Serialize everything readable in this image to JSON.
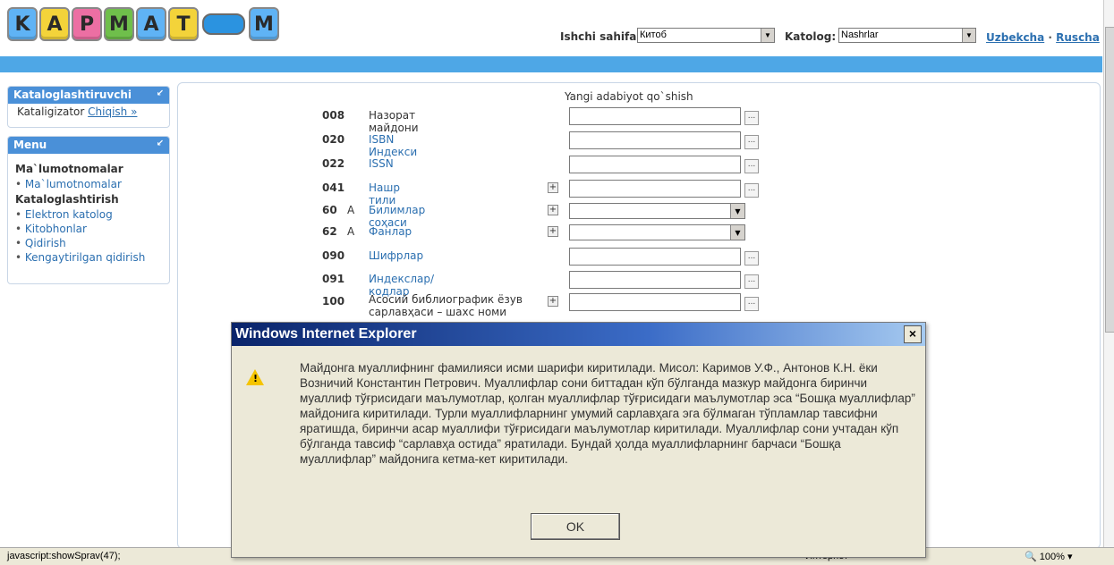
{
  "logo": {
    "letters": [
      "K",
      "A",
      "P",
      "M",
      "A",
      "T",
      "M"
    ],
    "colors": [
      "#5fb3f5",
      "#f3d33a",
      "#ec6fa3",
      "#6fbf4b",
      "#5fb3f5",
      "#f3d33a",
      "#5fb3f5"
    ]
  },
  "header": {
    "work_page_label": "Ishchi sahifa:",
    "work_page_value": "Китоб",
    "catalog_label": "Katolog:",
    "catalog_value": "Nashrlar",
    "lang_uz": "Uzbekcha",
    "lang_sep": "·",
    "lang_ru": "Ruscha"
  },
  "sidebar": {
    "cataloger_box": {
      "title": "Kataloglashtiruvchi",
      "user": "Kataligizator",
      "logout": "Chiqish »"
    },
    "menu_box": {
      "title": "Menu",
      "groups": [
        {
          "title": "Ma`lumotnomalar",
          "items": [
            "Ma`lumotnomalar"
          ]
        },
        {
          "title": "Kataloglashtirish",
          "items": [
            "Elektron katolog",
            "Kitobhonlar",
            "Qidirish",
            "Kengaytirilgan qidirish"
          ]
        }
      ]
    }
  },
  "form": {
    "title": "Yangi adabiyot qo`shish",
    "rows": [
      {
        "code": "008",
        "ind": "",
        "label": "Назорат майдони",
        "type": "text",
        "plus": false
      },
      {
        "code": "020",
        "ind": "",
        "label": "ISBN Индекси",
        "type": "text",
        "plus": false
      },
      {
        "code": "022",
        "ind": "",
        "label": "ISSN",
        "type": "text",
        "plus": false
      },
      {
        "code": "041",
        "ind": "",
        "label": "Нашр тили",
        "type": "text",
        "plus": true
      },
      {
        "code": "60",
        "ind": "A",
        "label": "Билимлар соҳаси",
        "type": "select",
        "plus": true
      },
      {
        "code": "62",
        "ind": "A",
        "label": "Фанлар",
        "type": "select",
        "plus": true
      },
      {
        "code": "090",
        "ind": "",
        "label": "Шифрлар",
        "type": "text",
        "plus": false
      },
      {
        "code": "091",
        "ind": "",
        "label": "Индекслар/кодлар",
        "type": "text",
        "plus": false
      },
      {
        "code": "100",
        "ind": "",
        "label": "Асосий  библиографик  ёзув сарлавҳаси – шахс номи",
        "type": "text",
        "plus": true
      }
    ]
  },
  "dialog": {
    "title": "Windows Internet Explorer",
    "close": "×",
    "message": "Майдонга муаллифнинг фамилияси исми шарифи киритилади. Мисол: Каримов У.Ф., Антонов К.Н. ёки Возничий Константин Петрович. Муаллифлар сони биттадан кўп бўлганда мазкур майдонга биринчи муаллиф тўғрисидаги маълумотлар, қолган муаллифлар тўғрисидаги маълумотлар эса “Бошқа муаллифлар” майдонига киритилади. Турли муаллифларнинг умумий сарлавҳага эга бўлмаган тўпламлар тавсифни яратишда, биринчи асар муаллифи тўғрисидаги маълумотлар киритилади. Муаллифлар сони учтадан кўп бўлганда тавсиф “сарлавҳа остида” яратилади. Бундай ҳолда муаллифларнинг барчаси “Бошқа муаллифлар” майдонига кетма-кет киритилади.",
    "ok": "OK"
  },
  "statusbar": {
    "status": "javascript:showSprav(47);",
    "zone": "Интернет",
    "zoom": "100%"
  }
}
